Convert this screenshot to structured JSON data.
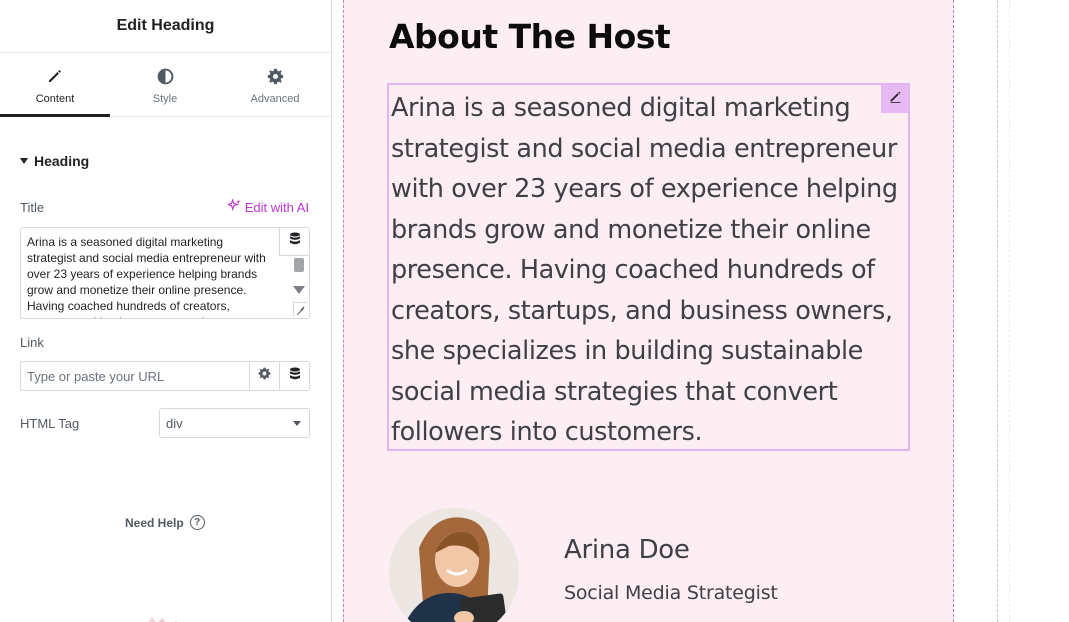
{
  "panel": {
    "title": "Edit Heading",
    "tabs": [
      {
        "label": "Content",
        "icon": "pencil-icon",
        "active": true
      },
      {
        "label": "Style",
        "icon": "half-circle-icon",
        "active": false
      },
      {
        "label": "Advanced",
        "icon": "gear-icon",
        "active": false
      }
    ],
    "section_label": "Heading",
    "title_label": "Title",
    "edit_ai_label": "Edit with AI",
    "title_value": "Arina is a seasoned digital marketing strategist and social media entrepreneur with over 23 years of experience helping brands grow and monetize their online presence. Having coached hundreds of creators, startups, and business owners, she specializes in building sustainable social media strategies that convert followers into customers.",
    "link_label": "Link",
    "link_placeholder": "Type or paste your URL",
    "html_tag_label": "HTML Tag",
    "html_tag_value": "div",
    "need_help_label": "Need Help",
    "help_icon_glyph": "?"
  },
  "canvas": {
    "heading": "About The Host",
    "bio_lines": [
      "Arina is a seasoned digital marketing",
      "strategist and social media entrepreneur",
      "with over 23 years of experience helping",
      "brands grow and monetize their online",
      "presence. Having coached hundreds of",
      "creators, startups, and business owners,",
      "she specializes in building sustainable",
      "social media strategies that convert",
      "followers into customers."
    ],
    "host_name": "Arina Doe",
    "host_role": "Social Media Strategist"
  },
  "colors": {
    "accent_ai": "#c036d1",
    "section_bg": "#fdeef3",
    "selection_border": "#e2b5f2"
  }
}
